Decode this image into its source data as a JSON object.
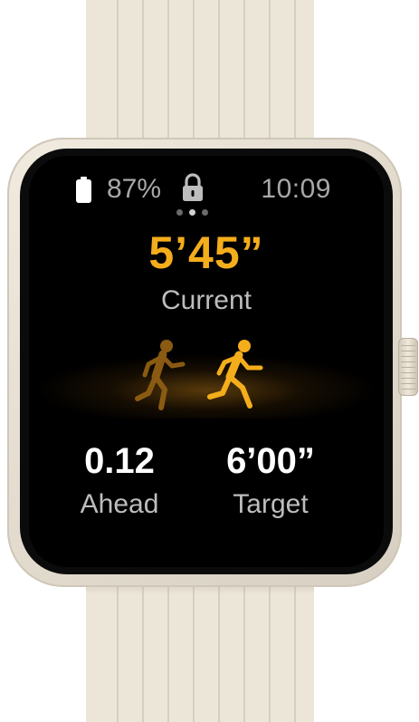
{
  "status_bar": {
    "battery_percent": "87%",
    "time": "10:09",
    "icons": [
      "battery-icon",
      "lock-icon"
    ]
  },
  "page_indicator": {
    "count": 3,
    "active_index": 1
  },
  "pace": {
    "current_value": "5’45”",
    "current_label": "Current"
  },
  "stats": {
    "ahead_value": "0.12",
    "ahead_label": "Ahead",
    "target_value": "6’00”",
    "target_label": "Target"
  },
  "colors": {
    "accent": "#f4ad1b",
    "runner_dim": "#8a5a12",
    "screen_bg": "#000000",
    "case": "#ece6d9"
  }
}
